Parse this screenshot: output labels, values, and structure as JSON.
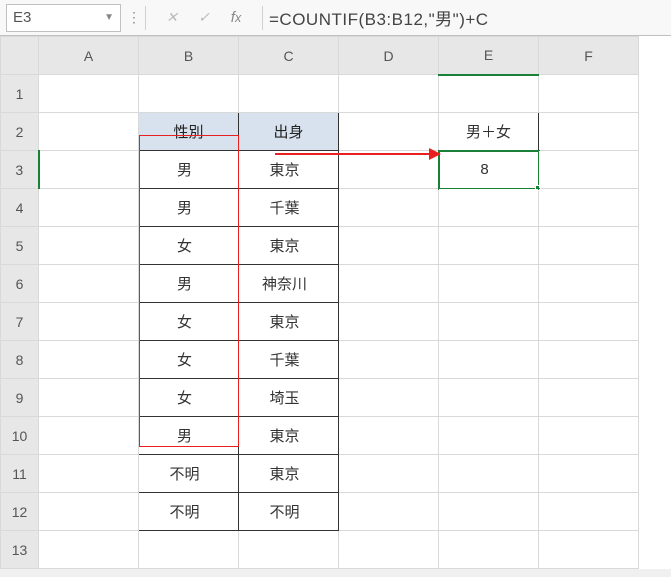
{
  "name_box": "E3",
  "formula": "=COUNTIF(B3:B12,\"男\")+C",
  "columns": [
    "A",
    "B",
    "C",
    "D",
    "E",
    "F"
  ],
  "rows": [
    "1",
    "2",
    "3",
    "4",
    "5",
    "6",
    "7",
    "8",
    "9",
    "10",
    "11",
    "12",
    "13"
  ],
  "headers": {
    "b2": "性別",
    "c2": "出身",
    "e2": "男＋女"
  },
  "table": [
    {
      "b": "男",
      "c": "東京"
    },
    {
      "b": "男",
      "c": "千葉"
    },
    {
      "b": "女",
      "c": "東京"
    },
    {
      "b": "男",
      "c": "神奈川"
    },
    {
      "b": "女",
      "c": "東京"
    },
    {
      "b": "女",
      "c": "千葉"
    },
    {
      "b": "女",
      "c": "埼玉"
    },
    {
      "b": "男",
      "c": "東京"
    },
    {
      "b": "不明",
      "c": "東京"
    },
    {
      "b": "不明",
      "c": "不明"
    }
  ],
  "result": "8",
  "chart_data": {
    "type": "table",
    "title": "",
    "columns": [
      "性別",
      "出身"
    ],
    "rows": [
      [
        "男",
        "東京"
      ],
      [
        "男",
        "千葉"
      ],
      [
        "女",
        "東京"
      ],
      [
        "男",
        "神奈川"
      ],
      [
        "女",
        "東京"
      ],
      [
        "女",
        "千葉"
      ],
      [
        "女",
        "埼玉"
      ],
      [
        "男",
        "東京"
      ],
      [
        "不明",
        "東京"
      ],
      [
        "不明",
        "不明"
      ]
    ],
    "summary": {
      "label": "男＋女",
      "value": 8
    }
  }
}
